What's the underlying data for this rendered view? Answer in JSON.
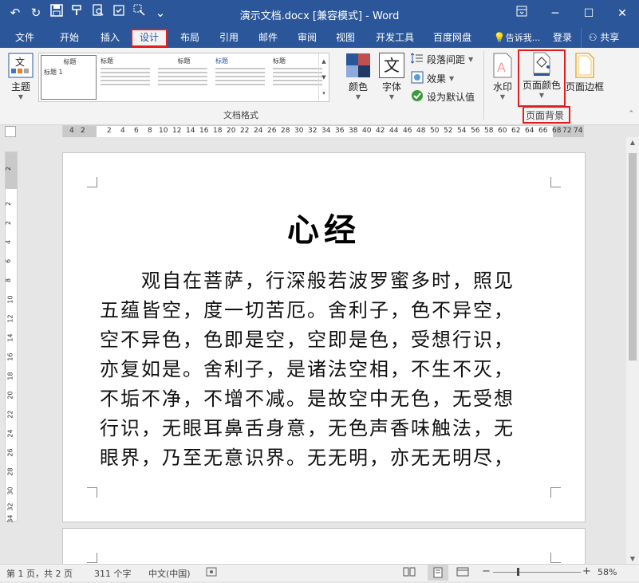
{
  "window": {
    "title": "演示文档.docx [兼容模式] - Word",
    "min": "─",
    "restore": "☐",
    "close": "✕",
    "options_icon": "ribbon-display-options-icon"
  },
  "qat": {
    "undo": "↶",
    "redo": "↻",
    "save": "💾",
    "format_painter": "⎘",
    "preview": "🔍",
    "extra1": "☐",
    "extra2": "⇲",
    "more": "⌄"
  },
  "tabs": [
    "文件",
    "开始",
    "插入",
    "设计",
    "布局",
    "引用",
    "邮件",
    "审阅",
    "视图",
    "开发工具",
    "百度网盘"
  ],
  "tell_me": "告诉我...",
  "login": "登录",
  "share": "共享",
  "ribbon": {
    "theme_label": "主题",
    "theme_icon_text": "文",
    "gallery_titles": [
      "标题",
      "标题",
      "标题",
      "标题",
      "标题",
      "标题"
    ],
    "gallery_sub": "标题 1",
    "colors_label": "颜色",
    "fonts_label": "字体",
    "fonts_icon_text": "文",
    "paragraph_spacing": "段落间距",
    "effects": "效果",
    "set_default": "设为默认值",
    "group_doc_format": "文档格式",
    "watermark": "水印",
    "page_color": "页面颜色",
    "page_border": "页面边框",
    "group_page_bg": "页面背景"
  },
  "ruler_h": [
    "4",
    "2",
    "2",
    "4",
    "6",
    "8",
    "10",
    "12",
    "14",
    "16",
    "18",
    "20",
    "22",
    "24",
    "26",
    "28",
    "30",
    "32",
    "34",
    "36",
    "38",
    "40",
    "42",
    "44",
    "46",
    "48",
    "50",
    "52",
    "54",
    "56",
    "58",
    "60",
    "62",
    "64",
    "66",
    "68",
    "72",
    "74"
  ],
  "ruler_v": [
    "2",
    "2",
    "2",
    "4",
    "6",
    "8",
    "10",
    "12",
    "14",
    "16",
    "18",
    "20",
    "22",
    "24",
    "26",
    "28",
    "30",
    "32",
    "34"
  ],
  "document": {
    "heading": "心经",
    "lines": [
      "　　观自在菩萨，行深般若波罗蜜多时，照见",
      "五蕴皆空，度一切苦厄。舍利子，色不异空，",
      "空不异色，色即是空，空即是色，受想行识，",
      "亦复如是。舍利子，是诸法空相，不生不灭，",
      "不垢不净，不增不减。是故空中无色，无受想",
      "行识，无眼耳鼻舌身意，无色声香味触法，无",
      "眼界，乃至无意识界。无无明，亦无无明尽，"
    ]
  },
  "status": {
    "page": "第 1 页，共 2 页",
    "words": "311 个字",
    "lang": "中文(中国)",
    "zoom": "58%",
    "zoom_minus": "−",
    "zoom_plus": "+"
  },
  "colors": {
    "brand": "#2b579a",
    "highlight": "#e02020"
  }
}
